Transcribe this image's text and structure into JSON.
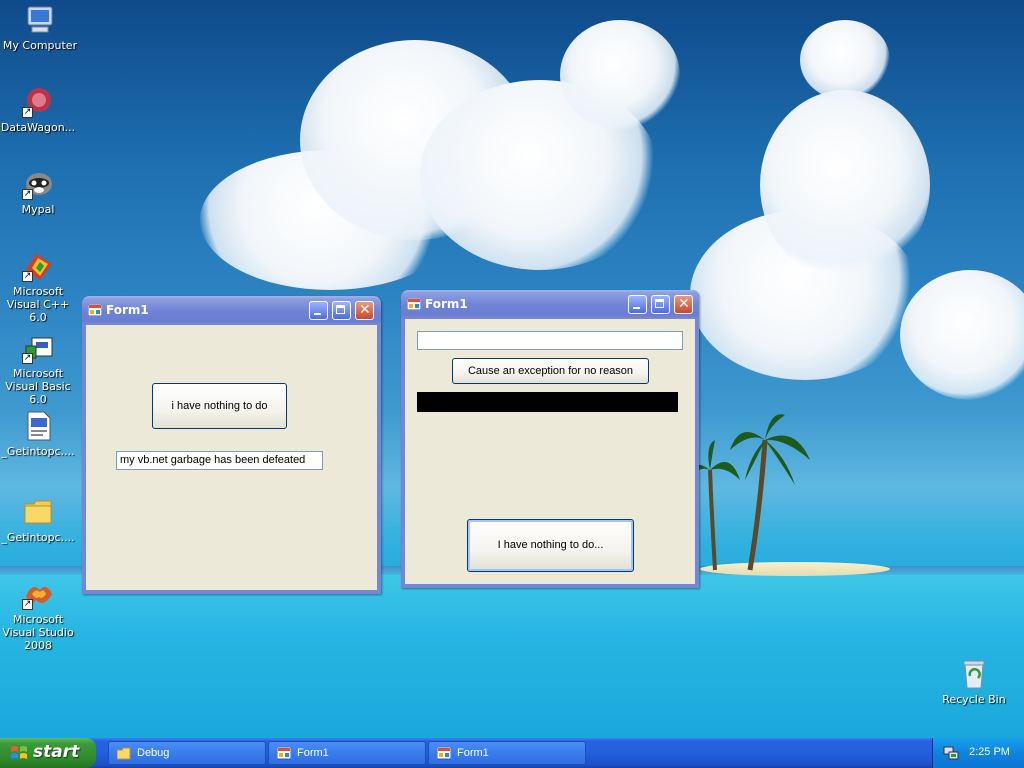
{
  "desktop": {
    "icons": [
      {
        "label": "My Computer"
      },
      {
        "label": "DataWagon..."
      },
      {
        "label": "Mypal"
      },
      {
        "label": "Microsoft Visual C++ 6.0"
      },
      {
        "label": "Microsoft Visual Basic 6.0"
      },
      {
        "label": "_Getintopc...."
      },
      {
        "label": "_Getintopc...."
      },
      {
        "label": "Microsoft Visual Studio 2008"
      },
      {
        "label": "Recycle Bin"
      }
    ]
  },
  "window1": {
    "title": "Form1",
    "button_label": "i have nothing to do",
    "textbox_value": "my vb.net garbage has been defeated"
  },
  "window2": {
    "title": "Form1",
    "textbox_value": "",
    "exception_button_label": "Cause an exception for no reason",
    "bottom_button_label": "I have nothing to do..."
  },
  "taskbar": {
    "start_label": "start",
    "tasks": [
      {
        "label": "Debug",
        "icon": "folder-icon"
      },
      {
        "label": "Form1",
        "icon": "form-icon"
      },
      {
        "label": "Form1",
        "icon": "form-icon"
      }
    ],
    "clock": "2:25 PM"
  },
  "colors": {
    "titlebar_inactive": "#7183d6",
    "client": "#ece9d8",
    "taskbar": "#245edb",
    "start_green": "#3c9a38"
  }
}
